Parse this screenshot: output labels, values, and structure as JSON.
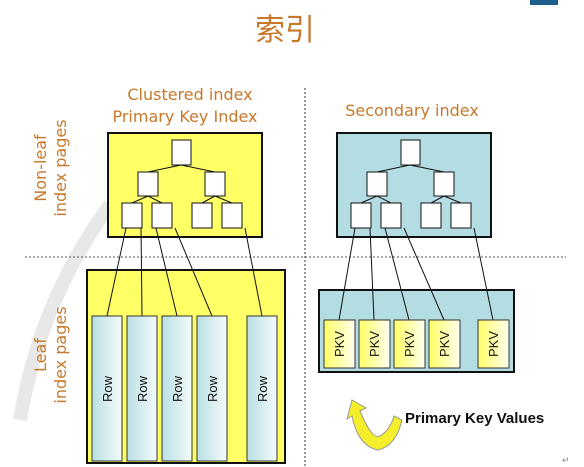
{
  "title": "索引",
  "left_panel": {
    "title_line1": "Clustered index",
    "title_line2": "Primary Key Index",
    "leaf_label": "Row",
    "leaf_count": 5
  },
  "right_panel": {
    "title": "Secondary index",
    "leaf_label": "PKV",
    "leaf_count": 5
  },
  "row_labels": {
    "nonleaf_line1": "Non-leaf",
    "nonleaf_line2": "index pages",
    "leaf_line1": "Leaf",
    "leaf_line2": "index pages"
  },
  "legend": {
    "text": "Primary Key Values"
  },
  "colors": {
    "orange": "#c8782a",
    "yellow": "#ffff66",
    "blue": "#b3dde3",
    "arrow": "#f5ee2a"
  }
}
